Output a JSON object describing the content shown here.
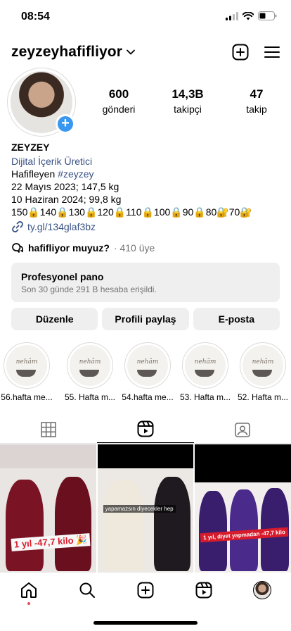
{
  "status": {
    "time": "08:54"
  },
  "header": {
    "username": "zeyzeyhafifliyor"
  },
  "profile": {
    "stats": [
      {
        "value": "600",
        "label": "gönderi"
      },
      {
        "value": "14,3B",
        "label": "takipçi"
      },
      {
        "value": "47",
        "label": "takip"
      }
    ],
    "name": "ZEYZEY",
    "category": "Dijital İçerik Üretici",
    "bio_prefix": "Hafifleyen ",
    "bio_hashtag": "#zeyzey",
    "bio_line2": "22 Mayıs 2023; 147,5 kg",
    "bio_line3": "10 Haziran 2024; 99,8 kg",
    "bio_line4": "150🔒140🔒130🔒120🔒110🔒100🔒90🔒80🔐70🔐",
    "link": "ty.gl/134glaf3bz",
    "group_name": "hafifliyor muyuz?",
    "group_members": "· 410 üye"
  },
  "pro_panel": {
    "title": "Profesyonel pano",
    "subtitle": "Son 30 günde 291 B hesaba erişildi."
  },
  "buttons": {
    "edit": "Düzenle",
    "share": "Profili paylaş",
    "email": "E-posta"
  },
  "highlights": [
    {
      "label": "56.hafta me...",
      "cover_text": "nehâm"
    },
    {
      "label": "55. Hafta m...",
      "cover_text": "nehâm"
    },
    {
      "label": "54.hafta me...",
      "cover_text": "nehâm"
    },
    {
      "label": "53. Hafta m...",
      "cover_text": "nehâm"
    },
    {
      "label": "52. Hafta m...",
      "cover_text": "nehâm"
    }
  ],
  "posts": [
    {
      "caption": "1 yıl -47,7 kilo 🎉"
    },
    {
      "caption": "yapamazsın diyecekler hep"
    },
    {
      "caption": "1 yıl, diyet yapmadan -47,7 kilo"
    }
  ]
}
